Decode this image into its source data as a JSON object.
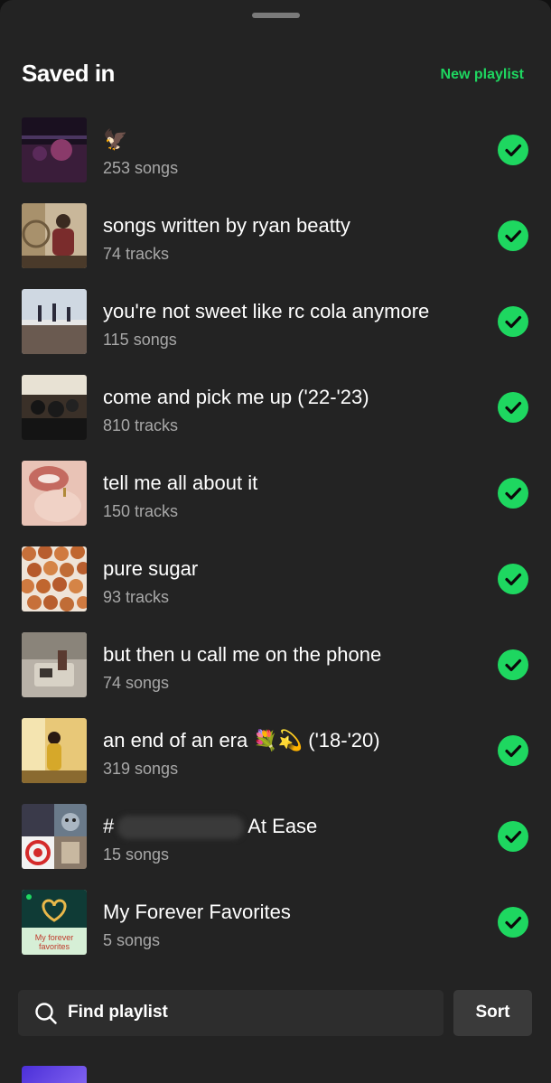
{
  "header": {
    "title": "Saved in",
    "new_playlist_label": "New playlist"
  },
  "playlists": [
    {
      "title": "🦅",
      "subtitle": "253 songs",
      "saved": true
    },
    {
      "title": "songs written by ryan beatty",
      "subtitle": "74 tracks",
      "saved": true
    },
    {
      "title": "you're not sweet like rc cola anymore",
      "subtitle": "115 songs",
      "saved": true
    },
    {
      "title": "come and pick me up ('22-'23)",
      "subtitle": "810 tracks",
      "saved": true
    },
    {
      "title": "tell me all about it",
      "subtitle": "150 tracks",
      "saved": true
    },
    {
      "title": "pure sugar",
      "subtitle": "93 tracks",
      "saved": true
    },
    {
      "title": "but then u call me on the phone",
      "subtitle": "74 songs",
      "saved": true
    },
    {
      "title": "an end of an era 💐💫 ('18-'20)",
      "subtitle": "319 songs",
      "saved": true
    },
    {
      "title_prefix": "#",
      "title_suffix": "At Ease",
      "subtitle": "15 songs",
      "saved": true
    },
    {
      "title": "My Forever Favorites",
      "subtitle": "5 songs",
      "saved": true,
      "cover_text": "My forever favorites"
    }
  ],
  "search": {
    "placeholder": "Find playlist",
    "icon": "search-icon"
  },
  "sort": {
    "label": "Sort"
  },
  "colors": {
    "accent": "#1ed760",
    "sheet_background": "#232323",
    "secondary_text": "#a8a8a8"
  }
}
